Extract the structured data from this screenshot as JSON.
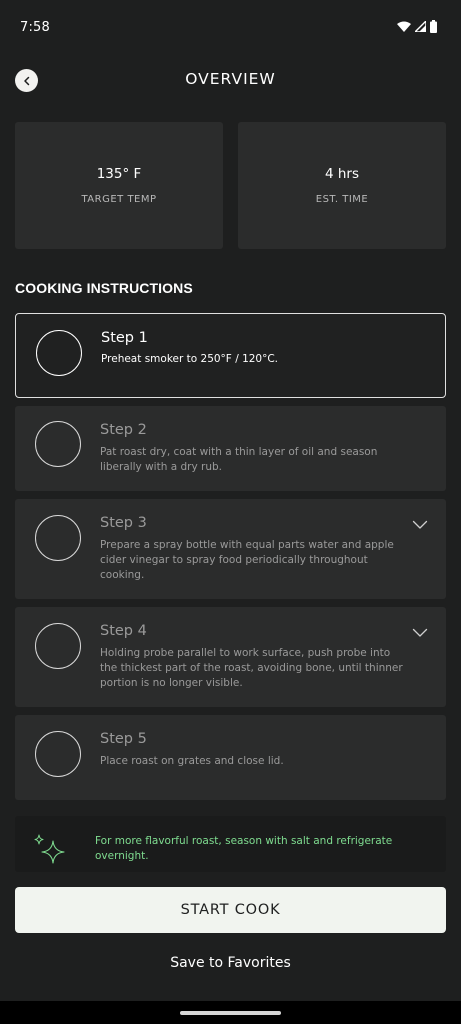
{
  "status_bar": {
    "time": "7:58"
  },
  "header": {
    "title": "OVERVIEW"
  },
  "stats": [
    {
      "value": "135° F",
      "label": "TARGET TEMP"
    },
    {
      "value": "4 hrs",
      "label": "EST. TIME"
    }
  ],
  "instructions": {
    "title": "COOKING INSTRUCTIONS",
    "steps": [
      {
        "title": "Step 1",
        "text": "Preheat smoker to 250°F / 120°C."
      },
      {
        "title": "Step 2",
        "text": "Pat roast dry, coat with a thin layer of oil and season liberally with a dry rub."
      },
      {
        "title": "Step 3",
        "text": "Prepare a spray bottle with equal parts water and apple cider vinegar to spray food periodically throughout cooking."
      },
      {
        "title": "Step 4",
        "text": "Holding probe parallel to work surface, push probe into the thickest part of the roast, avoiding bone, until thinner portion is no longer visible."
      },
      {
        "title": "Step 5",
        "text": "Place roast on grates and close lid."
      }
    ]
  },
  "tip": {
    "text": "For more flavorful roast, season with salt and refrigerate overnight.",
    "icon": "sparkle-icon"
  },
  "actions": {
    "start_label": "START COOK",
    "favorites_label": "Save to Favorites"
  },
  "colors": {
    "background": "#1e1f1f",
    "card": "#2b2c2c",
    "tip_text": "#7fdc90",
    "button": "#f1f4ef"
  }
}
